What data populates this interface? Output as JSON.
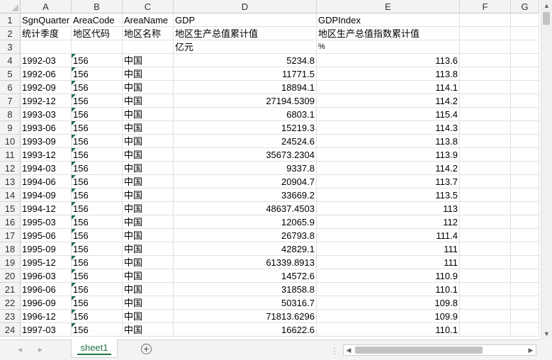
{
  "columns": [
    "A",
    "B",
    "C",
    "D",
    "E",
    "F",
    "G"
  ],
  "rows": [
    {
      "n": "1",
      "a": "SgnQuarter",
      "b": "AreaCode",
      "c": "AreaName",
      "d": "GDP",
      "e": "GDPIndex"
    },
    {
      "n": "2",
      "a": "统计季度",
      "b": "地区代码",
      "c": "地区名称",
      "d": "地区生产总值累计值",
      "e": "地区生产总值指数累计值"
    },
    {
      "n": "3",
      "a": "",
      "b": "",
      "c": "",
      "d": "亿元",
      "e": "%"
    },
    {
      "n": "4",
      "a": "1992-03",
      "b": "156",
      "c": "中国",
      "d": "5234.8",
      "e": "113.6"
    },
    {
      "n": "5",
      "a": "1992-06",
      "b": "156",
      "c": "中国",
      "d": "11771.5",
      "e": "113.8"
    },
    {
      "n": "6",
      "a": "1992-09",
      "b": "156",
      "c": "中国",
      "d": "18894.1",
      "e": "114.1"
    },
    {
      "n": "7",
      "a": "1992-12",
      "b": "156",
      "c": "中国",
      "d": "27194.5309",
      "e": "114.2"
    },
    {
      "n": "8",
      "a": "1993-03",
      "b": "156",
      "c": "中国",
      "d": "6803.1",
      "e": "115.4"
    },
    {
      "n": "9",
      "a": "1993-06",
      "b": "156",
      "c": "中国",
      "d": "15219.3",
      "e": "114.3"
    },
    {
      "n": "10",
      "a": "1993-09",
      "b": "156",
      "c": "中国",
      "d": "24524.6",
      "e": "113.8"
    },
    {
      "n": "11",
      "a": "1993-12",
      "b": "156",
      "c": "中国",
      "d": "35673.2304",
      "e": "113.9"
    },
    {
      "n": "12",
      "a": "1994-03",
      "b": "156",
      "c": "中国",
      "d": "9337.8",
      "e": "114.2"
    },
    {
      "n": "13",
      "a": "1994-06",
      "b": "156",
      "c": "中国",
      "d": "20904.7",
      "e": "113.7"
    },
    {
      "n": "14",
      "a": "1994-09",
      "b": "156",
      "c": "中国",
      "d": "33669.2",
      "e": "113.5"
    },
    {
      "n": "15",
      "a": "1994-12",
      "b": "156",
      "c": "中国",
      "d": "48637.4503",
      "e": "113"
    },
    {
      "n": "16",
      "a": "1995-03",
      "b": "156",
      "c": "中国",
      "d": "12065.9",
      "e": "112"
    },
    {
      "n": "17",
      "a": "1995-06",
      "b": "156",
      "c": "中国",
      "d": "26793.8",
      "e": "111.4"
    },
    {
      "n": "18",
      "a": "1995-09",
      "b": "156",
      "c": "中国",
      "d": "42829.1",
      "e": "111"
    },
    {
      "n": "19",
      "a": "1995-12",
      "b": "156",
      "c": "中国",
      "d": "61339.8913",
      "e": "111"
    },
    {
      "n": "20",
      "a": "1996-03",
      "b": "156",
      "c": "中国",
      "d": "14572.6",
      "e": "110.9"
    },
    {
      "n": "21",
      "a": "1996-06",
      "b": "156",
      "c": "中国",
      "d": "31858.8",
      "e": "110.1"
    },
    {
      "n": "22",
      "a": "1996-09",
      "b": "156",
      "c": "中国",
      "d": "50316.7",
      "e": "109.8"
    },
    {
      "n": "23",
      "a": "1996-12",
      "b": "156",
      "c": "中国",
      "d": "71813.6296",
      "e": "109.9"
    },
    {
      "n": "24",
      "a": "1997-03",
      "b": "156",
      "c": "中国",
      "d": "16622.6",
      "e": "110.1"
    }
  ],
  "sheet_tabs": [
    "sheet1"
  ],
  "add_sheet_glyph": "+",
  "colors": {
    "accent": "#217346",
    "header_bg": "#f3f3f3",
    "gridline": "#e1e1e1",
    "text_flag": "#1e7145"
  },
  "icons": {
    "add_sheet": "plus-circle-icon",
    "nav_prev": "chevron-left-icon",
    "nav_next": "chevron-right-icon"
  }
}
